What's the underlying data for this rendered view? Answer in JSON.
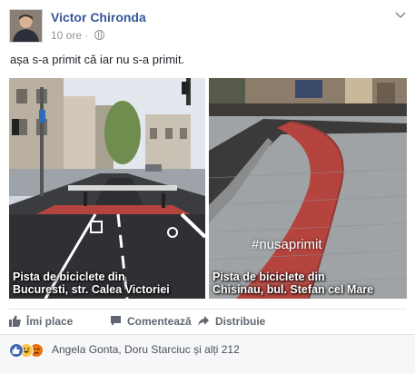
{
  "post": {
    "author": "Victor Chironda",
    "time": "10 ore",
    "separator": "·",
    "text": "așa s-a primit că iar nu s-a primit."
  },
  "images": [
    {
      "caption_line1": "Pista de biciclete din",
      "caption_line2": "Bucuresti, str. Calea Victoriei"
    },
    {
      "caption_line1": "Pista de biciclete din",
      "caption_line2": "Chisinau, bul. Stefan cel Mare",
      "hashtag": "#nusaprimit"
    }
  ],
  "actions": {
    "like": "Îmi place",
    "comment": "Comentează",
    "share": "Distribuie"
  },
  "reactions": {
    "icons": [
      "like",
      "haha",
      "angry"
    ],
    "names": "Angela Gonta, Doru Starciuc și alți 212"
  },
  "colors": {
    "link": "#365899",
    "brand_blue": "#4267b2",
    "bike_lane_red": "#b5443e"
  }
}
